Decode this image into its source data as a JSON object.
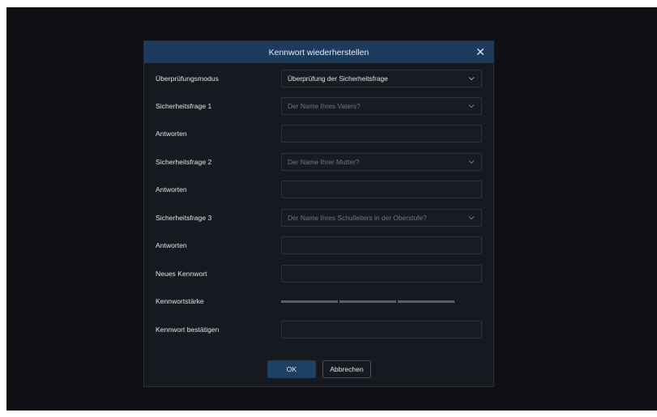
{
  "dialog": {
    "title": "Kennwort wiederherstellen",
    "close_icon": "close-icon",
    "accent_color": "#1d3b5c"
  },
  "form": {
    "verification_mode": {
      "label": "Überprüfungsmodus",
      "value": "Überprüfung der Sicherheitsfrage"
    },
    "security_question_1": {
      "label": "Sicherheitsfrage 1",
      "value": "Der Name Ihres Vaters?"
    },
    "answer_1": {
      "label": "Antworten",
      "value": ""
    },
    "security_question_2": {
      "label": "Sicherheitsfrage 2",
      "value": "Der Name Ihrer Mutter?"
    },
    "answer_2": {
      "label": "Antworten",
      "value": ""
    },
    "security_question_3": {
      "label": "Sicherheitsfrage 3",
      "value": "Der Name Ihres Schulleiters in der Oberstufe?"
    },
    "answer_3": {
      "label": "Antworten",
      "value": ""
    },
    "new_password": {
      "label": "Neues Kennwort",
      "value": ""
    },
    "password_strength": {
      "label": "Kennwortstärke",
      "level": 0
    },
    "confirm_password": {
      "label": "Kennwort bestätigen",
      "value": ""
    }
  },
  "buttons": {
    "ok": "OK",
    "cancel": "Abbrechen"
  }
}
